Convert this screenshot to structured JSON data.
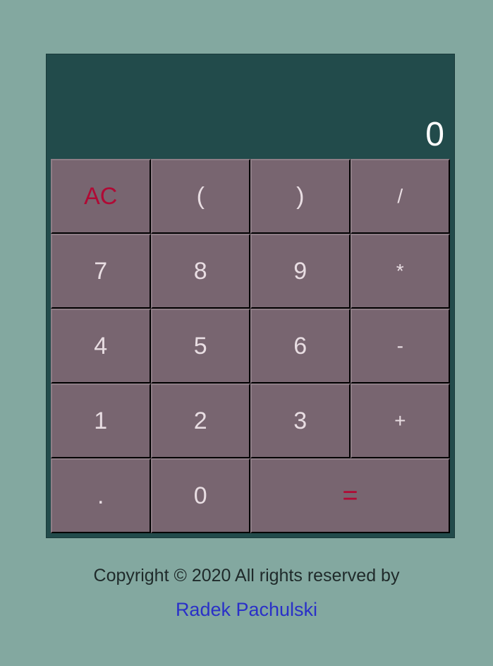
{
  "display": {
    "value": "0"
  },
  "keys": [
    {
      "label": "AC",
      "role": "clear"
    },
    {
      "label": "(",
      "role": "paren"
    },
    {
      "label": ")",
      "role": "paren"
    },
    {
      "label": "/",
      "role": "operator"
    },
    {
      "label": "7",
      "role": "digit"
    },
    {
      "label": "8",
      "role": "digit"
    },
    {
      "label": "9",
      "role": "digit"
    },
    {
      "label": "*",
      "role": "operator"
    },
    {
      "label": "4",
      "role": "digit"
    },
    {
      "label": "5",
      "role": "digit"
    },
    {
      "label": "6",
      "role": "digit"
    },
    {
      "label": "-",
      "role": "operator"
    },
    {
      "label": "1",
      "role": "digit"
    },
    {
      "label": "2",
      "role": "digit"
    },
    {
      "label": "3",
      "role": "digit"
    },
    {
      "label": "+",
      "role": "operator"
    },
    {
      "label": ".",
      "role": "decimal"
    },
    {
      "label": "0",
      "role": "digit"
    },
    {
      "label": "=",
      "role": "equals"
    }
  ],
  "footer": {
    "copyright": "Copyright © 2020 All rights reserved by",
    "author": "Radek Pachulski"
  },
  "colors": {
    "background": "#83a8a0",
    "calculator": "#224b4b",
    "key": "#786570",
    "key_text": "#e8dde2",
    "accent": "#b00a35",
    "link": "#2a30c8"
  }
}
